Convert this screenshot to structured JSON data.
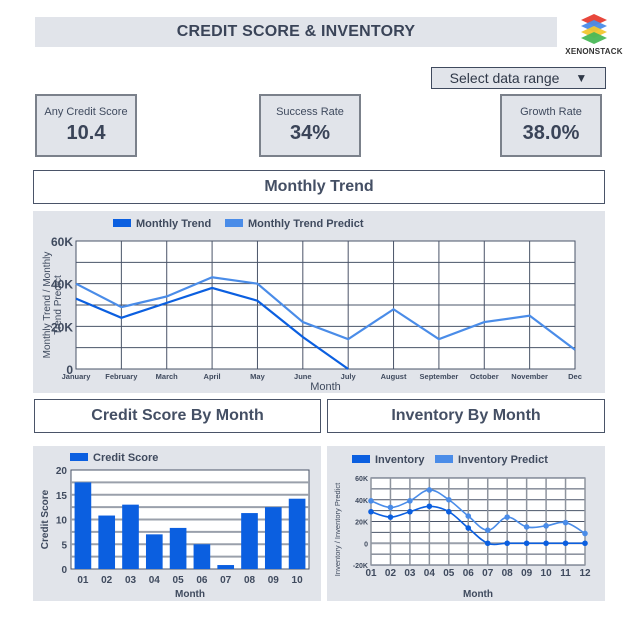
{
  "header": {
    "title": "CREDIT SCORE & INVENTORY",
    "logo_text": "XENONSTACK"
  },
  "dropdown": {
    "label": "Select data range",
    "icon": "caret-down-icon",
    "arrow": "▼"
  },
  "kpis": [
    {
      "label": "Any Credit Score",
      "value": "10.4"
    },
    {
      "label": "Success Rate",
      "value": "34%"
    },
    {
      "label": "Growth Rate",
      "value": "38.0%"
    }
  ],
  "sections": {
    "monthly_trend": "Monthly Trend",
    "credit_score": "Credit Score By Month",
    "inventory": "Inventory By Month"
  },
  "colors": {
    "primary": "#0b5fe0",
    "secondary": "#4a8ce8",
    "panel": "#e1e4ea",
    "text": "#3f4a5e"
  },
  "chart_data": [
    {
      "id": "monthly-trend",
      "type": "line",
      "title": "Monthly Trend",
      "xlabel": "Month",
      "ylabel": "Monthly Trend / Monthly Trend Predict",
      "categories": [
        "January",
        "February",
        "March",
        "April",
        "May",
        "June",
        "July",
        "August",
        "September",
        "October",
        "November",
        "Dec"
      ],
      "ylim": [
        0,
        60000
      ],
      "yticks": [
        0,
        20000,
        40000,
        60000
      ],
      "ytick_labels": [
        "0",
        "20K",
        "40K",
        "60K"
      ],
      "grid_step": 10000,
      "legend": "top-left",
      "series": [
        {
          "name": "Monthly Trend",
          "values": [
            33000,
            24000,
            31000,
            38000,
            32000,
            15000,
            0,
            null,
            null,
            null,
            null,
            null
          ]
        },
        {
          "name": "Monthly Trend Predict",
          "values": [
            40000,
            29000,
            34000,
            43000,
            40000,
            22000,
            14000,
            28000,
            14000,
            22000,
            25000,
            9000
          ]
        }
      ]
    },
    {
      "id": "credit-score",
      "type": "bar",
      "title": "Credit Score By Month",
      "xlabel": "Month",
      "ylabel": "Credit Score",
      "categories": [
        "01",
        "02",
        "03",
        "04",
        "05",
        "06",
        "07",
        "08",
        "09",
        "10"
      ],
      "ylim": [
        0,
        20
      ],
      "yticks": [
        0,
        5,
        10,
        15,
        20
      ],
      "grid_step": 2.5,
      "legend": "top-left",
      "series": [
        {
          "name": "Credit Score",
          "values": [
            17.5,
            10.8,
            13.0,
            7.0,
            8.3,
            5.0,
            0.8,
            11.3,
            12.5,
            14.2
          ]
        }
      ]
    },
    {
      "id": "inventory",
      "type": "line",
      "title": "Inventory By Month",
      "xlabel": "Month",
      "ylabel": "Inventory / Inventory Predict",
      "categories": [
        "01",
        "02",
        "03",
        "04",
        "05",
        "06",
        "07",
        "08",
        "09",
        "10",
        "11",
        "12"
      ],
      "ylim": [
        -20000,
        60000
      ],
      "yticks": [
        -20000,
        0,
        20000,
        40000,
        60000
      ],
      "ytick_labels": [
        "-20K",
        "0",
        "20K",
        "40K",
        "60K"
      ],
      "grid_step": 10000,
      "legend": "top-left",
      "series": [
        {
          "name": "Inventory",
          "values": [
            29000,
            24000,
            29000,
            34000,
            29000,
            14000,
            0,
            0,
            0,
            0,
            0,
            0
          ]
        },
        {
          "name": "Inventory Predict",
          "values": [
            39000,
            33000,
            39000,
            49000,
            40000,
            25000,
            12000,
            24000,
            15000,
            16000,
            19000,
            9000
          ]
        }
      ]
    }
  ]
}
